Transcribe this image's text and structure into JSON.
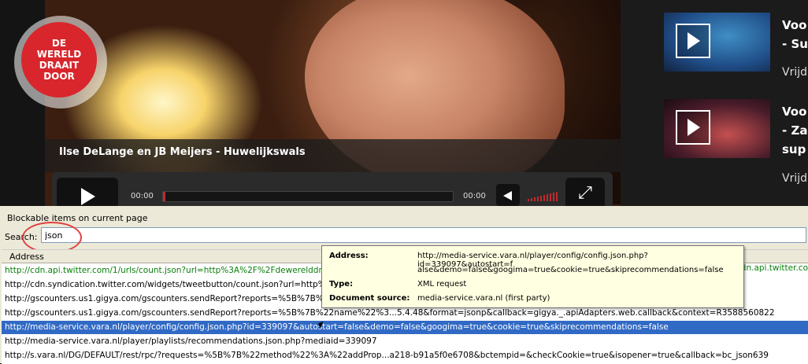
{
  "video": {
    "logo_lines": [
      "DE",
      "WERELD",
      "DRAAIT",
      "DOOR"
    ],
    "title": "Ilse DeLange en JB Meijers - Huwelijkswals",
    "time_current": "00:00",
    "time_total": "00:00",
    "progress_fraction": 0.0
  },
  "sidebar": {
    "items": [
      {
        "title_lines": [
          "Voo",
          "- Su"
        ],
        "date": "Vrijd"
      },
      {
        "title_lines": [
          "Voo",
          "- Za",
          "sup"
        ],
        "date": "Vrijd"
      }
    ]
  },
  "panel": {
    "header": "Blockable items on current page",
    "search_label": "Search:",
    "search_value": "json",
    "column_address": "Address",
    "rows": [
      {
        "text": "http://cdn.api.twitter.com/1/urls/count.json?url=http%3A%2F%2Fdewerelddraaitdoo",
        "style": "green"
      },
      {
        "text": "http://cdn.syndication.twitter.com/widgets/tweetbutton/count.json?url=http%3A%",
        "style": "normal"
      },
      {
        "text": "http://gscounters.us1.gigya.com/gscounters.sendReport?reports=%5B%7B%22na",
        "style": "normal"
      },
      {
        "text": "http://gscounters.us1.gigya.com/gscounters.sendReport?reports=%5B%7B%22name%22%3...5.4.48&format=jsonp&callback=gigya._.apiAdapters.web.callback&context=R3588560822",
        "style": "normal"
      },
      {
        "text": "http://media-service.vara.nl/player/config/config.json.php?id=339097&autostart=false&demo=false&googima=true&cookie=true&skiprecommendations=false",
        "style": "selected"
      },
      {
        "text": "http://media-service.vara.nl/player/playlists/recommendations.json.php?mediaid=339097",
        "style": "normal"
      },
      {
        "text": "http://s.vara.nl/DG/DEFAULT/rest/rpc/?requests=%5B%7B%22method%22%3A%22addProp...a218-b91a5f0e6708&bctempid=&checkCookie=true&isopener=true&callback=bc_json639",
        "style": "normal"
      }
    ],
    "right_fragment": "dn.api.twitter.co"
  },
  "tooltip": {
    "address_label": "Address:",
    "address_value_line1": "http://media-service.vara.nl/player/config/config.json.php?id=339097&autostart=f",
    "address_value_line2": "alse&demo=false&googima=true&cookie=true&skiprecommendations=false",
    "type_label": "Type:",
    "type_value": "XML request",
    "source_label": "Document source:",
    "source_value": "media-service.vara.nl (first party)"
  },
  "colors": {
    "brand_red": "#d8262c",
    "selection_blue": "#316ac5",
    "third_party_green": "#0a7d0a",
    "tooltip_bg": "#ffffe1"
  }
}
